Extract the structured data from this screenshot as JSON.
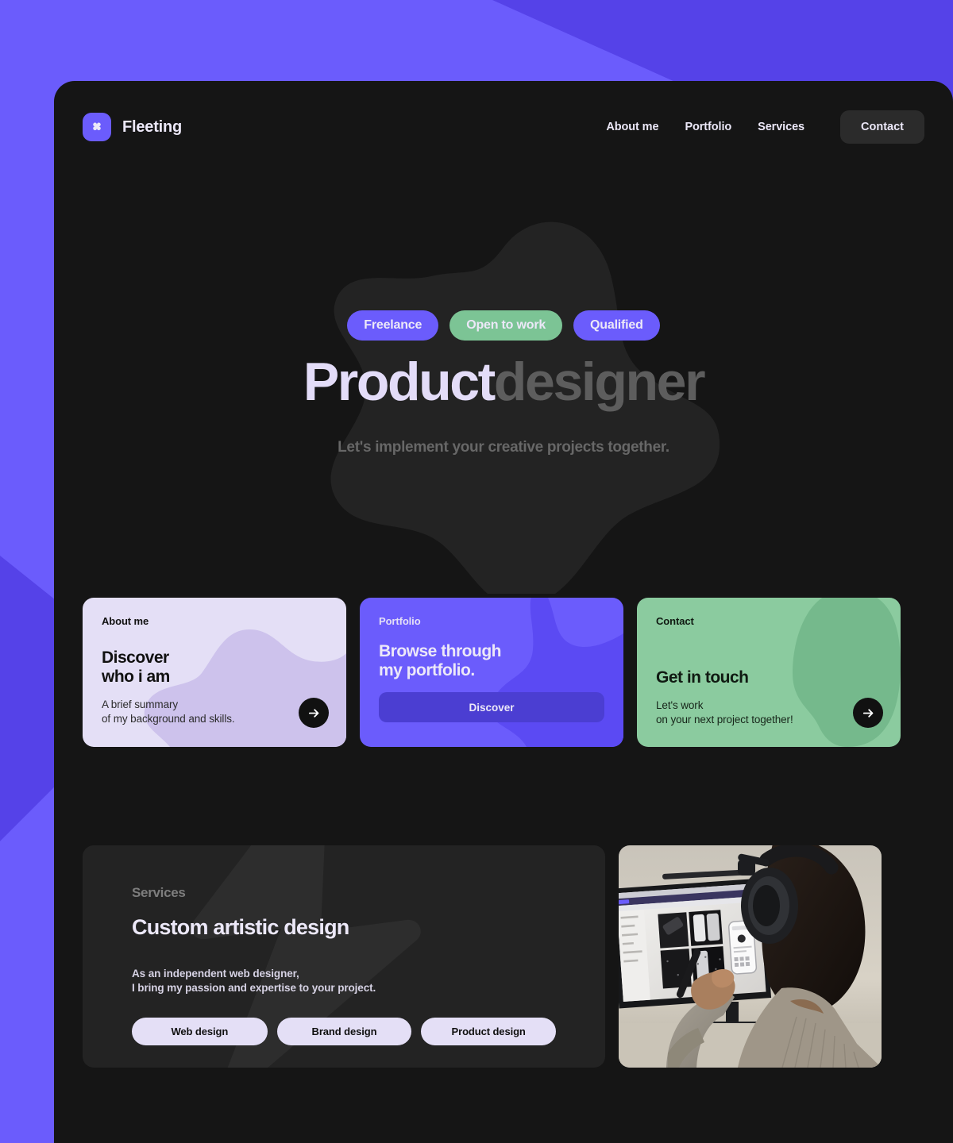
{
  "theme": {
    "page_bg_light": "#6b5cfc",
    "page_bg_dark": "#5542e8",
    "panel_bg": "#151515",
    "accent_purple": "#6b5cfc",
    "accent_green": "#8bcb9f",
    "accent_lavender": "#e4dff6",
    "text_light": "#ece8f8",
    "text_muted": "#676767"
  },
  "header": {
    "brand_name": "Fleeting",
    "brand_icon": "clover-icon",
    "nav": [
      {
        "label": "About me"
      },
      {
        "label": "Portfolio"
      },
      {
        "label": "Services"
      }
    ],
    "contact_button": "Contact"
  },
  "hero": {
    "badges": [
      {
        "label": "Freelance",
        "color": "purple"
      },
      {
        "label": "Open to work",
        "color": "green"
      },
      {
        "label": "Qualified",
        "color": "purple"
      }
    ],
    "title_strong": "Product",
    "title_muted": "designer",
    "subtitle": "Let's implement your creative projects together."
  },
  "cards": [
    {
      "eyebrow": "About me",
      "heading_line1": "Discover",
      "heading_line2": "who i am",
      "desc_line1": "A brief summary",
      "desc_line2": "of my background and skills.",
      "action": "arrow-right-icon"
    },
    {
      "eyebrow": "Portfolio",
      "heading_line1": "Browse through",
      "heading_line2": "my portfolio.",
      "button_label": "Discover"
    },
    {
      "eyebrow": "Contact",
      "heading_line1": "Get in touch",
      "desc_line1": "Let's work",
      "desc_line2": "on your next project together!",
      "action": "arrow-right-icon"
    }
  ],
  "services": {
    "eyebrow": "Services",
    "title": "Custom artistic design",
    "desc_line1": "As an independent web designer,",
    "desc_line2": "I bring my passion and expertise to your project.",
    "tags": [
      {
        "label": "Web design"
      },
      {
        "label": "Brand design"
      },
      {
        "label": "Product design"
      }
    ],
    "photo_alt": "designer-at-desk-photo"
  }
}
